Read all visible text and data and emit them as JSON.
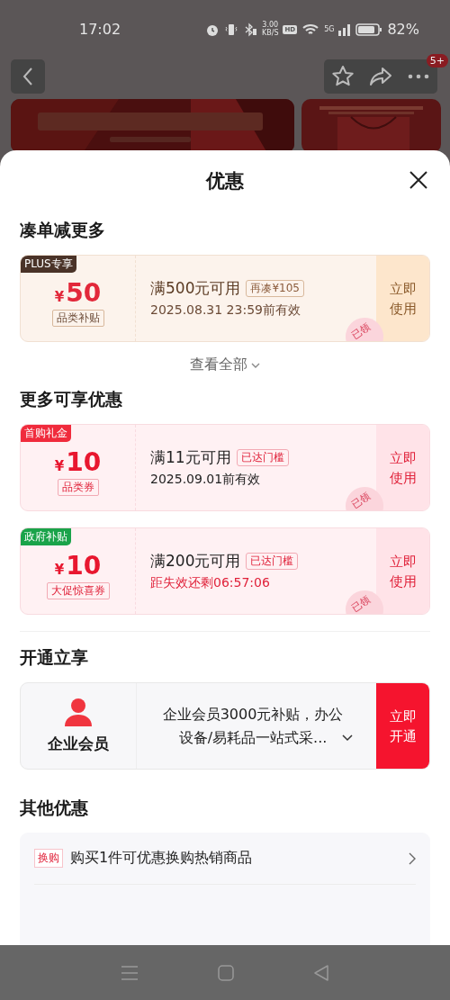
{
  "status_bar": {
    "time": "17:02",
    "speed": "3.00",
    "speed_unit": "KB/S",
    "hd": "HD",
    "network": "5G",
    "battery": "82%"
  },
  "nav": {
    "badge": "5+"
  },
  "sheet": {
    "title": "优惠"
  },
  "groups": [
    {
      "kind": "coupons",
      "title": "凑单减更多",
      "more": "查看全部",
      "coupons": [
        {
          "kind": "plus",
          "tag": "PLUS专享",
          "color": "#4a3328",
          "currency": "¥",
          "amount": "50",
          "category": "品类补贴",
          "condition": "满500元可用",
          "hint": "再凑¥105",
          "validity": "2025.08.31 23:59前有效",
          "urgent": false,
          "button": "立即使用",
          "stamp": "已领"
        }
      ]
    },
    {
      "kind": "coupons",
      "title": "更多可享优惠",
      "coupons": [
        {
          "kind": "red",
          "tag": "首购礼金",
          "color": "#f02b3c",
          "currency": "¥",
          "amount": "10",
          "category": "品类券",
          "condition": "满11元可用",
          "hint": "已达门槛",
          "validity": "2025.09.01前有效",
          "urgent": false,
          "button": "立即使用",
          "stamp": "已领"
        },
        {
          "kind": "red",
          "tag": "政府补贴",
          "color": "#1aa34a",
          "currency": "¥",
          "amount": "10",
          "category": "大促惊喜券",
          "condition": "满200元可用",
          "hint": "已达门槛",
          "validity": "距失效还剩06:57:06",
          "urgent": true,
          "button": "立即使用",
          "stamp": "已领"
        }
      ]
    },
    {
      "kind": "member",
      "title": "开通立享",
      "name": "企业会员",
      "text": "企业会员3000元补贴，办公设备/易耗品一站式采...",
      "button": "立即开通"
    },
    {
      "kind": "offers",
      "title": "其他优惠",
      "offers": [
        {
          "tag": "换购",
          "text": "购买1件可优惠换购热销商品"
        }
      ]
    }
  ]
}
